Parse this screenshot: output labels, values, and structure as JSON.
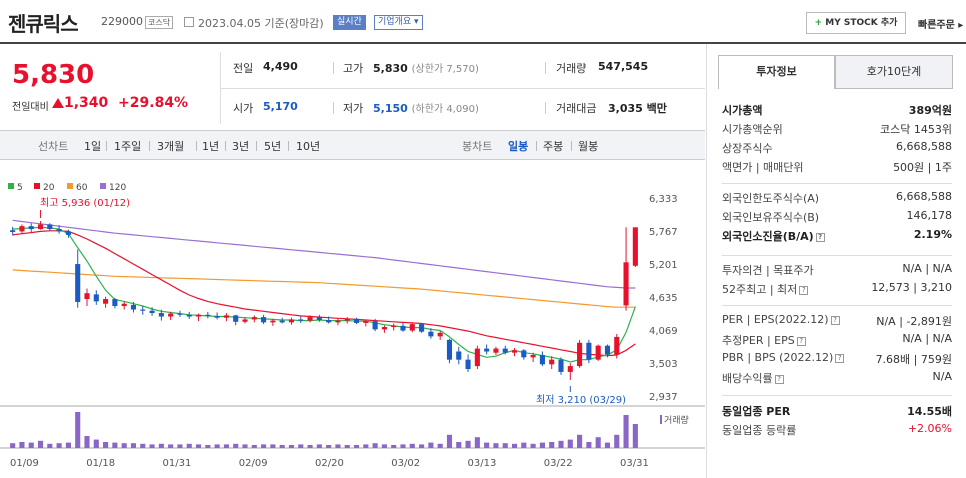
{
  "header": {
    "name": "젠큐릭스",
    "code": "229000",
    "market": "코스닥",
    "date": "2023.04.05",
    "basis": "기준(장마감)",
    "realtime": "실시간",
    "company_overview": "기업개요",
    "my_stock": "MY STOCK 추가",
    "my_stock_plus": "+",
    "quick_order": "빠른주문"
  },
  "quote": {
    "price": "5,830",
    "change_label": "전일대비",
    "change": "1,340",
    "change_pct": "+29.84%",
    "prev_label": "전일",
    "prev": "4,490",
    "high_label": "고가",
    "high": "5,830",
    "upper_limit": "(상한가 7,570)",
    "volume_label": "거래량",
    "volume": "547,545",
    "open_label": "시가",
    "open": "5,170",
    "low_label": "저가",
    "low": "5,150",
    "lower_limit": "(하한가 4,090)",
    "amount_label": "거래대금",
    "amount": "3,035",
    "amount_unit": "백만"
  },
  "range_bar": {
    "label": "선차트",
    "periods": [
      "1일",
      "1주일",
      "3개월",
      "1년",
      "3년",
      "5년",
      "10년"
    ],
    "candle_label": "봉차트",
    "candle_types": [
      "일봉",
      "주봉",
      "월봉"
    ],
    "active_candle": "일봉"
  },
  "chart_data": {
    "type": "candlestick",
    "legend": [
      {
        "name": "5",
        "color": "#2db34a"
      },
      {
        "name": "20",
        "color": "#e8112d"
      },
      {
        "name": "60",
        "color": "#f29a2e"
      },
      {
        "name": "120",
        "color": "#9b6fd1"
      }
    ],
    "y_ticks": [
      "6,333",
      "5,767",
      "5,201",
      "4,635",
      "4,069",
      "3,503",
      "2,937"
    ],
    "ylim": [
      2937,
      6333
    ],
    "x_ticks": [
      "01/09",
      "01/18",
      "01/31",
      "02/09",
      "02/20",
      "03/02",
      "03/13",
      "03/22",
      "03/31"
    ],
    "high_note": "최고 5,936 (01/12)",
    "low_note": "최저 3,210 (03/29)",
    "volume_label": "거래량",
    "candles": [
      [
        5780,
        5840,
        5690,
        5750
      ],
      [
        5760,
        5880,
        5720,
        5850
      ],
      [
        5850,
        5900,
        5740,
        5800
      ],
      [
        5800,
        5936,
        5790,
        5880
      ],
      [
        5880,
        5900,
        5770,
        5800
      ],
      [
        5800,
        5870,
        5720,
        5760
      ],
      [
        5760,
        5790,
        5650,
        5700
      ],
      [
        5200,
        5450,
        4450,
        4550
      ],
      [
        4600,
        4780,
        4480,
        4700
      ],
      [
        4680,
        4750,
        4500,
        4560
      ],
      [
        4520,
        4640,
        4450,
        4600
      ],
      [
        4600,
        4620,
        4440,
        4480
      ],
      [
        4480,
        4560,
        4420,
        4520
      ],
      [
        4500,
        4550,
        4370,
        4420
      ],
      [
        4420,
        4480,
        4330,
        4400
      ],
      [
        4400,
        4460,
        4310,
        4360
      ],
      [
        4360,
        4420,
        4230,
        4300
      ],
      [
        4300,
        4380,
        4240,
        4350
      ],
      [
        4350,
        4400,
        4290,
        4330
      ],
      [
        4330,
        4380,
        4260,
        4300
      ],
      [
        4300,
        4350,
        4220,
        4330
      ],
      [
        4330,
        4380,
        4270,
        4310
      ],
      [
        4310,
        4370,
        4250,
        4280
      ],
      [
        4280,
        4360,
        4220,
        4320
      ],
      [
        4320,
        4330,
        4150,
        4210
      ],
      [
        4210,
        4290,
        4180,
        4250
      ],
      [
        4250,
        4320,
        4200,
        4290
      ],
      [
        4290,
        4330,
        4170,
        4200
      ],
      [
        4200,
        4260,
        4140,
        4230
      ],
      [
        4230,
        4280,
        4180,
        4200
      ],
      [
        4200,
        4280,
        4160,
        4250
      ],
      [
        4250,
        4300,
        4190,
        4230
      ],
      [
        4230,
        4320,
        4200,
        4290
      ],
      [
        4290,
        4330,
        4210,
        4240
      ],
      [
        4240,
        4300,
        4180,
        4200
      ],
      [
        4200,
        4260,
        4150,
        4230
      ],
      [
        4230,
        4290,
        4180,
        4260
      ],
      [
        4260,
        4280,
        4170,
        4190
      ],
      [
        4190,
        4250,
        4130,
        4220
      ],
      [
        4220,
        4260,
        4050,
        4080
      ],
      [
        4080,
        4150,
        4020,
        4120
      ],
      [
        4120,
        4180,
        4060,
        4140
      ],
      [
        4140,
        4190,
        4040,
        4060
      ],
      [
        4060,
        4200,
        4030,
        4170
      ],
      [
        4170,
        4190,
        4020,
        4040
      ],
      [
        4040,
        4100,
        3920,
        3960
      ],
      [
        3960,
        4050,
        3900,
        4020
      ],
      [
        3900,
        3920,
        3500,
        3560
      ],
      [
        3700,
        3780,
        3480,
        3560
      ],
      [
        3560,
        3650,
        3350,
        3400
      ],
      [
        3450,
        3800,
        3400,
        3750
      ],
      [
        3750,
        3820,
        3650,
        3700
      ],
      [
        3680,
        3780,
        3640,
        3750
      ],
      [
        3750,
        3800,
        3650,
        3680
      ],
      [
        3680,
        3760,
        3620,
        3720
      ],
      [
        3720,
        3740,
        3560,
        3600
      ],
      [
        3600,
        3680,
        3520,
        3640
      ],
      [
        3640,
        3700,
        3450,
        3480
      ],
      [
        3480,
        3620,
        3400,
        3560
      ],
      [
        3560,
        3600,
        3300,
        3350
      ],
      [
        3350,
        3500,
        3210,
        3450
      ],
      [
        3450,
        3900,
        3420,
        3850
      ],
      [
        3850,
        3900,
        3500,
        3560
      ],
      [
        3560,
        3820,
        3540,
        3800
      ],
      [
        3800,
        3820,
        3600,
        3650
      ],
      [
        3650,
        4000,
        3580,
        3950
      ],
      [
        4490,
        5830,
        4400,
        5230
      ],
      [
        5170,
        5830,
        5150,
        5830
      ]
    ],
    "ma5": [
      5800,
      5810,
      5820,
      5830,
      5820,
      5800,
      5720,
      5480,
      5250,
      4990,
      4750,
      4590,
      4560,
      4520,
      4480,
      4430,
      4390,
      4370,
      4350,
      4330,
      4320,
      4310,
      4300,
      4300,
      4290,
      4280,
      4270,
      4260,
      4250,
      4240,
      4240,
      4230,
      4230,
      4240,
      4230,
      4230,
      4230,
      4220,
      4220,
      4190,
      4160,
      4140,
      4120,
      4110,
      4110,
      4080,
      4060,
      3950,
      3820,
      3700,
      3650,
      3600,
      3620,
      3680,
      3720,
      3680,
      3660,
      3630,
      3600,
      3570,
      3520,
      3560,
      3560,
      3610,
      3640,
      3730,
      4030,
      4470
    ],
    "ma20": [
      5700,
      5720,
      5740,
      5760,
      5770,
      5770,
      5760,
      5700,
      5630,
      5550,
      5470,
      5380,
      5290,
      5200,
      5110,
      5020,
      4930,
      4840,
      4750,
      4670,
      4610,
      4560,
      4520,
      4490,
      4460,
      4430,
      4410,
      4390,
      4370,
      4350,
      4330,
      4310,
      4300,
      4290,
      4280,
      4270,
      4260,
      4250,
      4240,
      4230,
      4220,
      4210,
      4200,
      4190,
      4180,
      4160,
      4140,
      4110,
      4080,
      4050,
      4010,
      3970,
      3940,
      3910,
      3880,
      3850,
      3820,
      3790,
      3760,
      3730,
      3700,
      3670,
      3650,
      3640,
      3630,
      3640,
      3720,
      3830
    ],
    "ma60": [
      5100,
      5090,
      5080,
      5070,
      5060,
      5050,
      5040,
      5030,
      5020,
      5010,
      5000,
      4990,
      4985,
      4980,
      4975,
      4970,
      4965,
      4960,
      4955,
      4950,
      4945,
      4940,
      4935,
      4930,
      4925,
      4920,
      4915,
      4910,
      4905,
      4900,
      4895,
      4890,
      4885,
      4880,
      4870,
      4860,
      4850,
      4840,
      4830,
      4820,
      4810,
      4800,
      4790,
      4780,
      4770,
      4755,
      4740,
      4725,
      4710,
      4695,
      4680,
      4665,
      4650,
      4635,
      4620,
      4605,
      4590,
      4575,
      4560,
      4545,
      4530,
      4515,
      4500,
      4485,
      4470,
      4460,
      4460,
      4460
    ],
    "ma120": [
      5950,
      5930,
      5910,
      5890,
      5870,
      5850,
      5830,
      5810,
      5790,
      5770,
      5750,
      5730,
      5715,
      5700,
      5685,
      5670,
      5655,
      5640,
      5625,
      5610,
      5595,
      5580,
      5565,
      5550,
      5535,
      5520,
      5505,
      5490,
      5475,
      5460,
      5445,
      5430,
      5415,
      5400,
      5385,
      5370,
      5355,
      5340,
      5325,
      5310,
      5290,
      5270,
      5250,
      5230,
      5210,
      5190,
      5170,
      5150,
      5130,
      5110,
      5090,
      5070,
      5050,
      5030,
      5010,
      4990,
      4970,
      4950,
      4930,
      4910,
      4890,
      4870,
      4850,
      4830,
      4810,
      4800,
      4790,
      4790
    ],
    "volumes": [
      8,
      10,
      9,
      12,
      7,
      8,
      9,
      60,
      20,
      14,
      10,
      9,
      8,
      8,
      7,
      6,
      7,
      6,
      6,
      7,
      6,
      5,
      6,
      6,
      7,
      6,
      5,
      6,
      6,
      5,
      5,
      6,
      5,
      6,
      5,
      6,
      5,
      5,
      6,
      8,
      6,
      5,
      6,
      7,
      6,
      9,
      7,
      22,
      10,
      12,
      18,
      9,
      8,
      8,
      7,
      9,
      7,
      9,
      10,
      12,
      14,
      22,
      10,
      18,
      9,
      22,
      55,
      40
    ]
  },
  "side": {
    "tab_invest": "투자정보",
    "tab_hoga": "호가10단계",
    "rows1": [
      {
        "l": "시가총액",
        "r": "389억원",
        "bold": true
      },
      {
        "l": "시가총액순위",
        "r": "코스닥 1453위"
      },
      {
        "l": "상장주식수",
        "r": "6,668,588"
      },
      {
        "l": "액면가 | 매매단위",
        "r": "500원 | 1주"
      }
    ],
    "rows2": [
      {
        "l": "외국인한도주식수(A)",
        "r": "6,668,588"
      },
      {
        "l": "외국인보유주식수(B)",
        "r": "146,178"
      },
      {
        "l": "외국인소진율(B/A)",
        "r": "2.19%",
        "bold": true
      }
    ],
    "rows3": [
      {
        "l": "투자의견 | 목표주가",
        "r": "N/A | N/A"
      },
      {
        "l": "52주최고 | 최저",
        "r": "12,573 | 3,210"
      }
    ],
    "rows4": [
      {
        "l": "PER | EPS(2022.12)",
        "r": "N/A | -2,891원"
      },
      {
        "l": "추정PER | EPS",
        "r": "N/A | N/A"
      },
      {
        "l": "PBR | BPS (2022.12)",
        "r": "7.68배 | 759원"
      },
      {
        "l": "배당수익률",
        "r": "N/A"
      }
    ],
    "rows5": [
      {
        "l": "동일업종 PER",
        "r": "14.55배",
        "bold": true
      },
      {
        "l": "동일업종 등락률",
        "r": "+2.06%",
        "red": true
      }
    ]
  }
}
